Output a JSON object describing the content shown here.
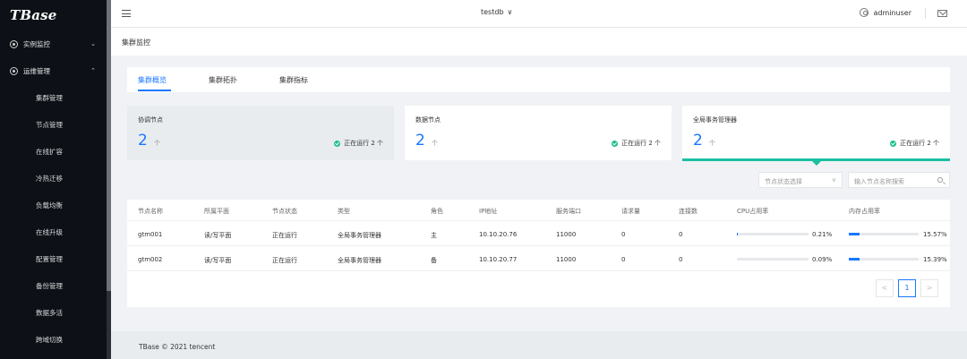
{
  "app": {
    "logo": "TBase"
  },
  "sidebar": {
    "groups": [
      {
        "label": "实例监控",
        "chevron": "⌄",
        "icon": "instance-icon"
      },
      {
        "label": "运维管理",
        "chevron": "⌃",
        "icon": "ops-icon"
      }
    ],
    "items": [
      "集群管理",
      "节点管理",
      "在线扩容",
      "冷热迁移",
      "负载均衡",
      "在线升级",
      "配置管理",
      "备份管理",
      "数据多活",
      "跨域切换"
    ]
  },
  "header": {
    "db": "testdb",
    "db_caret": "∨",
    "user": "adminuser"
  },
  "breadcrumb": "集群监控",
  "tabs": [
    "集群概览",
    "集群拓扑",
    "集群指标"
  ],
  "cards": [
    {
      "title": "协调节点",
      "count": "2",
      "unit": "个",
      "status": "正在运行 2 个"
    },
    {
      "title": "数据节点",
      "count": "2",
      "unit": "个",
      "status": "正在运行 2 个"
    },
    {
      "title": "全局事务管理器",
      "count": "2",
      "unit": "个",
      "status": "正在运行 2 个"
    }
  ],
  "filters": {
    "status_placeholder": "节点状态选择",
    "status_caret": "∨",
    "search_placeholder": "输入节点名称搜索"
  },
  "table": {
    "columns": [
      "节点名称",
      "所属平面",
      "节点状态",
      "类型",
      "角色",
      "IP地址",
      "服务端口",
      "请求量",
      "连接数",
      "CPU占用率",
      "内存占用率"
    ],
    "rows": [
      {
        "name": "gtm001",
        "plane": "读/写平面",
        "state": "正在运行",
        "type": "全局事务管理器",
        "role": "主",
        "ip": "10.10.20.76",
        "port": "11000",
        "requests": "0",
        "connections": "0",
        "cpu": "0.21%",
        "cpu_value": 0.21,
        "mem": "15.57%",
        "mem_value": 15.57
      },
      {
        "name": "gtm002",
        "plane": "读/写平面",
        "state": "正在运行",
        "type": "全局事务管理器",
        "role": "备",
        "ip": "10.10.20.77",
        "port": "11000",
        "requests": "0",
        "connections": "0",
        "cpu": "0.09%",
        "cpu_value": 0.09,
        "mem": "15.39%",
        "mem_value": 15.39
      }
    ]
  },
  "pagination": {
    "prev": "<",
    "current": "1",
    "next": ">"
  },
  "footer": "TBase © 2021 tencent",
  "colors": {
    "accent": "#1677ff",
    "success": "#1bbf8a",
    "sidebar_bg": "#0d1117"
  }
}
